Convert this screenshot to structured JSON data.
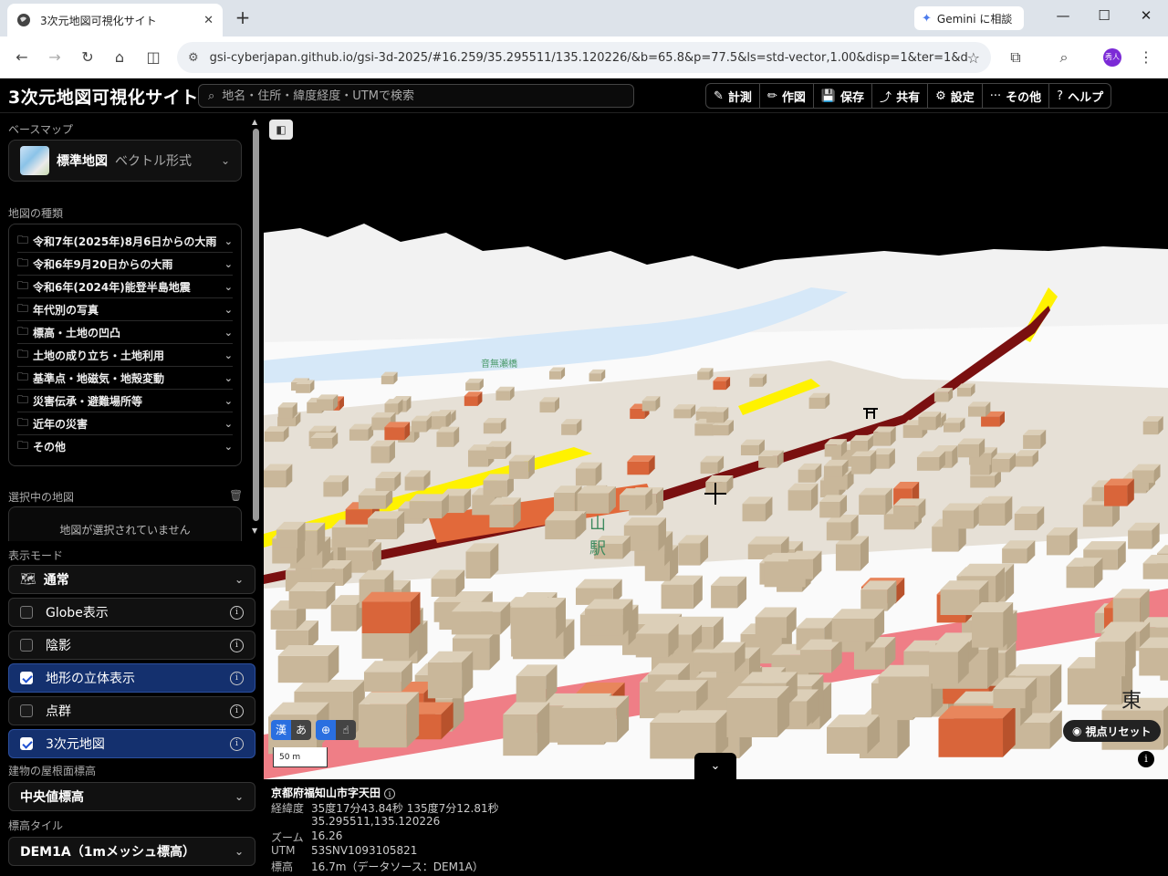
{
  "browser": {
    "tab_title": "3次元地図可視化サイト",
    "tab_close": "✕",
    "new_tab": "+",
    "gemini_label": "Gemini に相談",
    "url": "gsi-cyberjapan.github.io/gsi-3d-2025/#16.259/35.295511/135.120226/&b=65.8&p=77.5&ls=std-vector,1.00&disp=1&ter=1&d3...",
    "avatar_label": "秀人"
  },
  "app": {
    "title": "3次元地図可視化サイト",
    "search_placeholder": "地名・住所・緯度経度・UTMで検索",
    "tools": [
      {
        "icon": "✎",
        "label": "計測"
      },
      {
        "icon": "✏",
        "label": "作図"
      },
      {
        "icon": "💾",
        "label": "保存"
      },
      {
        "icon": "⤴",
        "label": "共有"
      },
      {
        "icon": "⚙",
        "label": "設定"
      },
      {
        "icon": "···",
        "label": "その他"
      },
      {
        "icon": "?",
        "label": "ヘルプ"
      }
    ]
  },
  "sidebar": {
    "basemap_label": "ベースマップ",
    "basemap_name": "標準地図",
    "basemap_type": "ベクトル形式",
    "maptypes_label": "地図の種類",
    "maptypes": [
      "令和7年(2025年)8月6日からの大雨",
      "令和6年9月20日からの大雨",
      "令和6年(2024年)能登半島地震",
      "年代別の写真",
      "標高・土地の凹凸",
      "土地の成り立ち・土地利用",
      "基準点・地磁気・地殻変動",
      "災害伝承・避難場所等",
      "近年の災害",
      "その他"
    ],
    "selected_label": "選択中の地図",
    "selected_empty": "地図が選択されていません",
    "display_mode_label": "表示モード",
    "display_mode": "通常",
    "toggles": [
      {
        "label": "Globe表示",
        "checked": false
      },
      {
        "label": "陰影",
        "checked": false
      },
      {
        "label": "地形の立体表示",
        "checked": true
      },
      {
        "label": "点群",
        "checked": false
      },
      {
        "label": "3次元地図",
        "checked": true
      }
    ],
    "roof_label": "建物の屋根面標高",
    "roof_value": "中央値標高",
    "elev_tile_label": "標高タイル",
    "elev_tile_value": "DEM1A（1mメッシュ標高）"
  },
  "map": {
    "lang_kanji": "漢",
    "lang_hira": "あ",
    "scale_label": "50 m",
    "reset_label": "視点リセット",
    "info_glyph": "i",
    "collapse_glyph": "⌄",
    "labels": {
      "station_partial": "山\n駅",
      "east": "東",
      "river": "音無瀬橋"
    }
  },
  "info": {
    "address": "京都府福知山市字天田",
    "rows": [
      {
        "k": "経緯度",
        "v": "35度17分43.84秒 135度7分12.81秒"
      },
      {
        "k": "",
        "v": "35.295511,135.120226"
      },
      {
        "k": "ズーム",
        "v": "16.26"
      },
      {
        "k": "UTM",
        "v": "53SNV1093105821"
      },
      {
        "k": "標高",
        "v": "16.7m（データソース：DEM1A）"
      }
    ]
  }
}
